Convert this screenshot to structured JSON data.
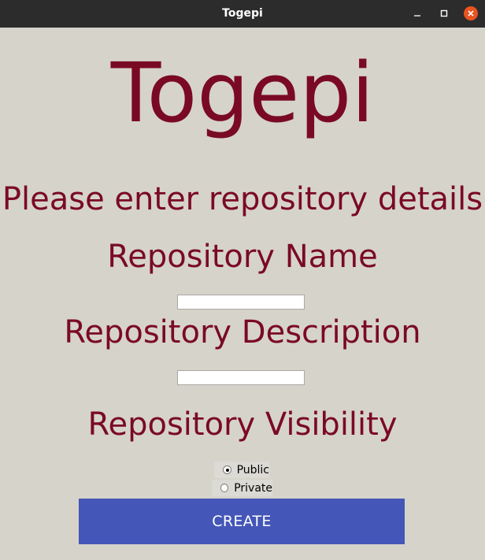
{
  "window": {
    "title": "Togepi",
    "controls": {
      "minimize_icon": "minimize-icon",
      "maximize_icon": "maximize-icon",
      "close_icon": "close-icon"
    }
  },
  "app": {
    "title": "Togepi",
    "prompt": "Please enter repository details"
  },
  "form": {
    "name_label": "Repository Name",
    "name_value": "",
    "description_label": "Repository Description",
    "description_value": "",
    "visibility_label": "Repository Visibility",
    "visibility_options": [
      {
        "label": "Public",
        "selected": true
      },
      {
        "label": "Private",
        "selected": false
      }
    ],
    "submit_label": "CREATE"
  },
  "colors": {
    "background": "#d6d3cb",
    "titlebar": "#2c2c2c",
    "heading_text": "#7a0a24",
    "button": "#4456b7",
    "close_button": "#e95420"
  }
}
